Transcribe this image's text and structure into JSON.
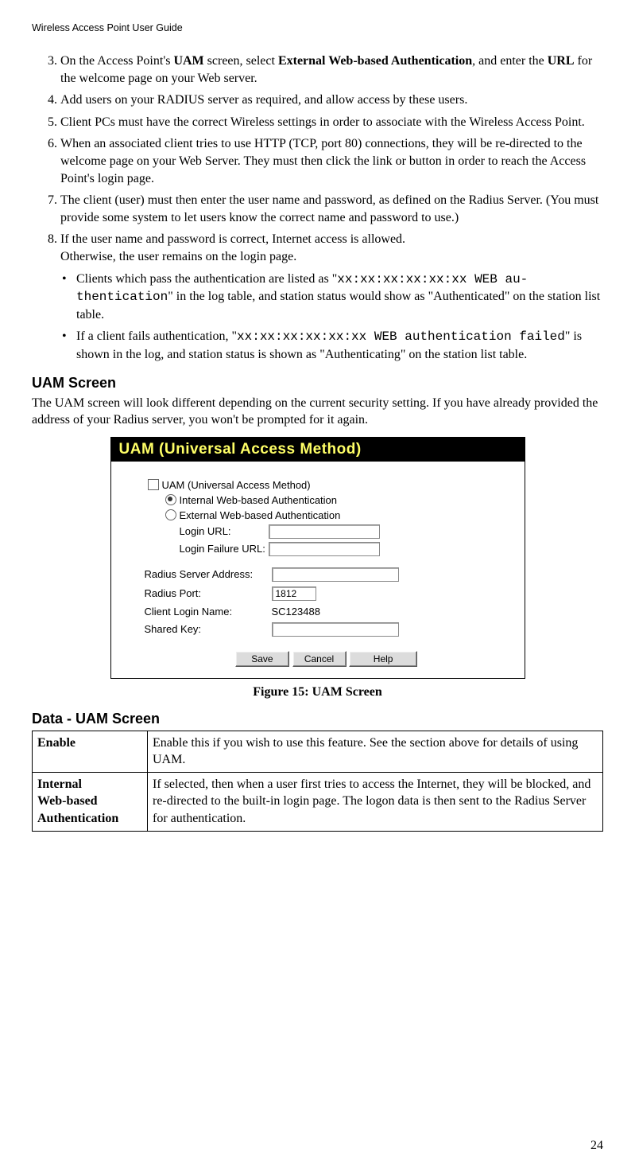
{
  "running_head": "Wireless Access Point User Guide",
  "steps": {
    "s3_pre": "On the Access Point's ",
    "s3_b1": "UAM",
    "s3_mid": " screen, select ",
    "s3_b2": "External Web-based Authentication",
    "s3_mid2": ", and enter the ",
    "s3_b3": "URL",
    "s3_end": " for the welcome page on your Web server.",
    "s4": "Add users on your RADIUS server as required, and allow access by these users.",
    "s5": "Client PCs must have the correct Wireless settings in order to associate with the Wireless Access Point.",
    "s6": "When an associated client tries to use HTTP (TCP, port 80) connections, they will be re-directed to the welcome page on your Web Server. They must then click the link or button in order to reach the Access Point's login page.",
    "s7": "The client (user) must then enter the user name and password, as defined on the Radius Server. (You must provide some system to let users know the correct name and password to use.)",
    "s8a": "If the user name and password is correct, Internet access is allowed.",
    "s8b": "Otherwise, the user remains on the login page.",
    "b1_pre": "Clients which pass the authentication are listed as  \"",
    "b1_code": "xx:xx:xx:xx:xx:xx WEB au-thentication",
    "b1_end": "\" in the log table, and station status would show as \"Authenticated\" on the station list table.",
    "b2_pre": "If a client fails authentication,  \"",
    "b2_code": "xx:xx:xx:xx:xx:xx WEB authentication failed",
    "b2_end": "\" is shown in the log, and station status is shown as  \"Authenticating\" on the station list table."
  },
  "headings": {
    "uam_screen": "UAM Screen",
    "data_uam_screen": "Data - UAM Screen"
  },
  "uam_intro": "The UAM screen will look different depending on the current security setting. If you have already provided the address of your Radius server, you won't be prompted for it again.",
  "figure_caption": "Figure 15: UAM Screen",
  "uam_ui": {
    "banner": "UAM (Universal Access Method)",
    "checkbox_label": "UAM (Universal Access Method)",
    "radio_internal": "Internal Web-based Authentication",
    "radio_external": "External Web-based Authentication",
    "login_url_label": "Login URL:",
    "login_failure_label": "Login Failure URL:",
    "radius_server_label": "Radius Server Address:",
    "radius_port_label": "Radius Port:",
    "radius_port_value": "1812",
    "client_login_label": "Client Login Name:",
    "client_login_value": "SC123488",
    "shared_key_label": "Shared Key:",
    "buttons": {
      "save": "Save",
      "cancel": "Cancel",
      "help": "Help"
    }
  },
  "table": {
    "rows": [
      {
        "k": "Enable",
        "v": "Enable this if you wish to use this feature. See the section above for details of using UAM."
      },
      {
        "k": "Internal",
        "k2": "Web-based",
        "k3": "Authentication",
        "v": "If selected, then when a user first tries to access the Internet, they will be blocked, and re-directed to the built-in login page. The logon data is then sent to the Radius Server for authentication."
      }
    ]
  },
  "page_number": "24"
}
